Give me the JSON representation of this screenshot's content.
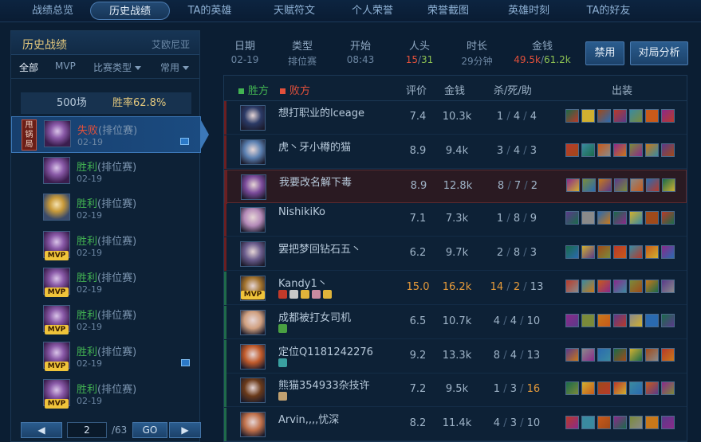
{
  "nav": {
    "tabs": [
      "战绩总览",
      "历史战绩",
      "TA的英雄",
      "天赋符文",
      "个人荣誉",
      "荣誉截图",
      "英雄时刻",
      "TA的好友"
    ],
    "active": 1
  },
  "left": {
    "title": "历史战绩",
    "region": "艾欧尼亚",
    "filters": {
      "all": "全部",
      "mvp": "MVP",
      "type": "比赛类型",
      "common": "常用"
    },
    "summary": {
      "games": "500场",
      "winrate": "胜率62.8%"
    },
    "matches": [
      {
        "result": "失败",
        "mode": "(排位赛)",
        "date": "02-19",
        "tag": "甩锅局",
        "mvp": false,
        "image": true,
        "win": false,
        "champ": "c1"
      },
      {
        "result": "胜利",
        "mode": "(排位赛)",
        "date": "02-19",
        "mvp": false,
        "image": false,
        "win": true,
        "champ": "c1"
      },
      {
        "result": "胜利",
        "mode": "(排位赛)",
        "date": "02-19",
        "mvp": false,
        "image": false,
        "win": true,
        "champ": "c2"
      },
      {
        "result": "胜利",
        "mode": "(排位赛)",
        "date": "02-19",
        "mvp": true,
        "image": false,
        "win": true,
        "champ": "c1"
      },
      {
        "result": "胜利",
        "mode": "(排位赛)",
        "date": "02-19",
        "mvp": true,
        "image": false,
        "win": true,
        "champ": "c1"
      },
      {
        "result": "胜利",
        "mode": "(排位赛)",
        "date": "02-19",
        "mvp": true,
        "image": false,
        "win": true,
        "champ": "c1"
      },
      {
        "result": "胜利",
        "mode": "(排位赛)",
        "date": "02-19",
        "mvp": true,
        "image": true,
        "win": true,
        "champ": "c1"
      },
      {
        "result": "胜利",
        "mode": "(排位赛)",
        "date": "02-19",
        "mvp": true,
        "image": false,
        "win": true,
        "champ": "c1"
      }
    ],
    "pager": {
      "prev": "◀",
      "page": "2",
      "total": "/63",
      "go": "GO",
      "next": "▶"
    }
  },
  "stats": {
    "date_label": "日期",
    "date": "02-19",
    "type_label": "类型",
    "type": "排位赛",
    "start_label": "开始",
    "start": "08:43",
    "kills_label": "人头",
    "kills_a": "15",
    "kills_sep": "/",
    "kills_b": "31",
    "duration_label": "时长",
    "duration": "29分钟",
    "gold_label": "金钱",
    "gold_a": "49.5k",
    "gold_sep": "/",
    "gold_b": "61.2k",
    "ban_button": "禁用",
    "analysis_button": "对局分析"
  },
  "table": {
    "legend_win": "胜方",
    "legend_lose": "败方",
    "headers": {
      "rating": "评价",
      "gold": "金钱",
      "kda": "杀/死/助",
      "items": "出装"
    },
    "players": [
      {
        "name": "想打职业的lceage",
        "rating": "7.4",
        "gold": "10.3k",
        "k": "1",
        "d": "4",
        "a": "4",
        "side": "lose",
        "color": "#2b3a66",
        "highlight": false,
        "mvp": false,
        "badges": []
      },
      {
        "name": "虎丶牙小樽的猫",
        "rating": "8.9",
        "gold": "9.4k",
        "k": "3",
        "d": "4",
        "a": "3",
        "side": "lose",
        "color": "#5a7fb0",
        "highlight": false,
        "mvp": false,
        "badges": []
      },
      {
        "name": "我要改名解下毒",
        "rating": "8.9",
        "gold": "12.8k",
        "k": "8",
        "d": "7",
        "a": "2",
        "side": "lose",
        "color": "#7a4a9a",
        "highlight": true,
        "mvp": false,
        "badges": []
      },
      {
        "name": "NishikiKo",
        "rating": "7.1",
        "gold": "7.3k",
        "k": "1",
        "d": "8",
        "a": "9",
        "side": "lose",
        "color": "#b48ab8",
        "highlight": false,
        "mvp": false,
        "badges": []
      },
      {
        "name": "罢把梦回钻石五丶",
        "rating": "6.2",
        "gold": "9.7k",
        "k": "2",
        "d": "8",
        "a": "3",
        "side": "lose",
        "color": "#6a5c8c",
        "highlight": false,
        "mvp": false,
        "badges": []
      },
      {
        "name": "Kandy1丶",
        "rating": "15.0",
        "gold": "16.2k",
        "k": "14",
        "d": "2",
        "a": "13",
        "side": "win",
        "color": "#a0702a",
        "highlight": false,
        "mvp": true,
        "badges": [
          "#c23a2a",
          "#c7c7c7",
          "#e0b43a",
          "#c98aa0",
          "#e0b43a"
        ],
        "best": true
      },
      {
        "name": "成都被打女司机",
        "rating": "6.5",
        "gold": "10.7k",
        "k": "4",
        "d": "4",
        "a": "10",
        "side": "win",
        "color": "#d0a080",
        "highlight": false,
        "mvp": false,
        "badges": [
          "#4aa042"
        ]
      },
      {
        "name": "定位Q1181242276",
        "rating": "9.2",
        "gold": "13.3k",
        "k": "8",
        "d": "4",
        "a": "13",
        "side": "win",
        "color": "#c05a2a",
        "highlight": false,
        "mvp": false,
        "badges": [
          "#3aa0a0"
        ]
      },
      {
        "name": "熊猫354933杂技许",
        "rating": "7.2",
        "gold": "9.5k",
        "k": "1",
        "d": "3",
        "a": "16",
        "side": "win",
        "color": "#6a3a1a",
        "highlight": false,
        "mvp": false,
        "badges": [
          "#c0a070"
        ],
        "a_orange": true
      },
      {
        "name": "Arvin,,,,忧深",
        "rating": "8.2",
        "gold": "11.4k",
        "k": "4",
        "d": "3",
        "a": "10",
        "side": "win",
        "color": "#c0704a",
        "highlight": false,
        "mvp": false,
        "badges": []
      }
    ]
  },
  "colors": {
    "win": "#42b352",
    "lose": "#e2503b",
    "gold": "#e2c77d",
    "orange": "#e59a3a",
    "item_palette": [
      "#1a6a4a",
      "#c85a1a",
      "#8a8a8a",
      "#b83a2a",
      "#c8781a",
      "#d0b030",
      "#8a2a8a",
      "#2a6ab0",
      "#3a8aa0",
      "#5a3a8a",
      "#a04a1a",
      "#7a8a3a"
    ]
  }
}
